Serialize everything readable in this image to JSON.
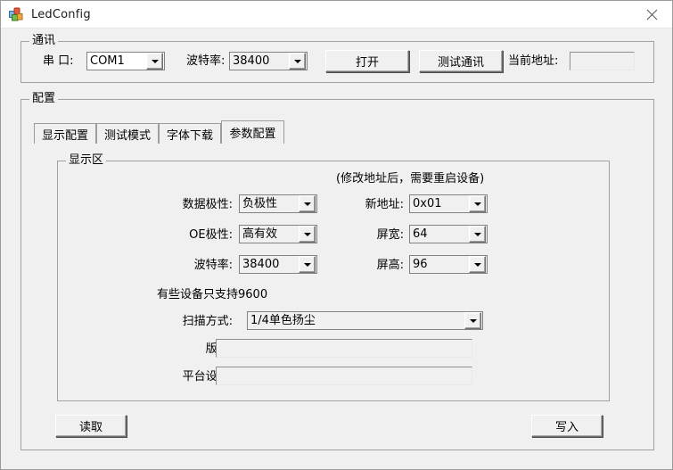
{
  "window": {
    "title": "LedConfig",
    "icon": "app-blocks-icon",
    "close_label": "✕"
  },
  "comm": {
    "group_title": "通讯",
    "port_label": "串 口:",
    "port_value": "COM1",
    "baud_label": "波特率:",
    "baud_value": "38400",
    "open_button": "打开",
    "test_button": "测试通讯",
    "current_addr_label": "当前地址:",
    "current_addr_value": ""
  },
  "config": {
    "group_title": "配置",
    "tabs": [
      {
        "label": "显示配置",
        "selected": false
      },
      {
        "label": "测试模式",
        "selected": false
      },
      {
        "label": "字体下载",
        "selected": false
      },
      {
        "label": "参数配置",
        "selected": true
      }
    ],
    "read_button": "读取",
    "write_button": "写入"
  },
  "display": {
    "group_title": "显示区",
    "note_restart": "(修改地址后，需要重启设备)",
    "note_baud": "有些设备只支持9600",
    "data_polarity_label": "数据极性:",
    "data_polarity_value": "负极性",
    "oe_polarity_label": "OE极性:",
    "oe_polarity_value": "高有效",
    "baud_label": "波特率:",
    "baud_value": "38400",
    "new_addr_label": "新地址:",
    "new_addr_value": "0x01",
    "screen_width_label": "屏宽:",
    "screen_width_value": "64",
    "screen_height_label": "屏高:",
    "screen_height_value": "96",
    "scan_mode_label": "扫描方式:",
    "scan_mode_value": "1/4单色扬尘",
    "version_label": "版本:",
    "version_value": "",
    "platform_label": "平台设备:",
    "platform_value": ""
  },
  "colors": {
    "window_bg": "#f0f0f0",
    "titlebar_bg": "#ffffff",
    "border": "#a0a0a0",
    "text": "#000000"
  }
}
